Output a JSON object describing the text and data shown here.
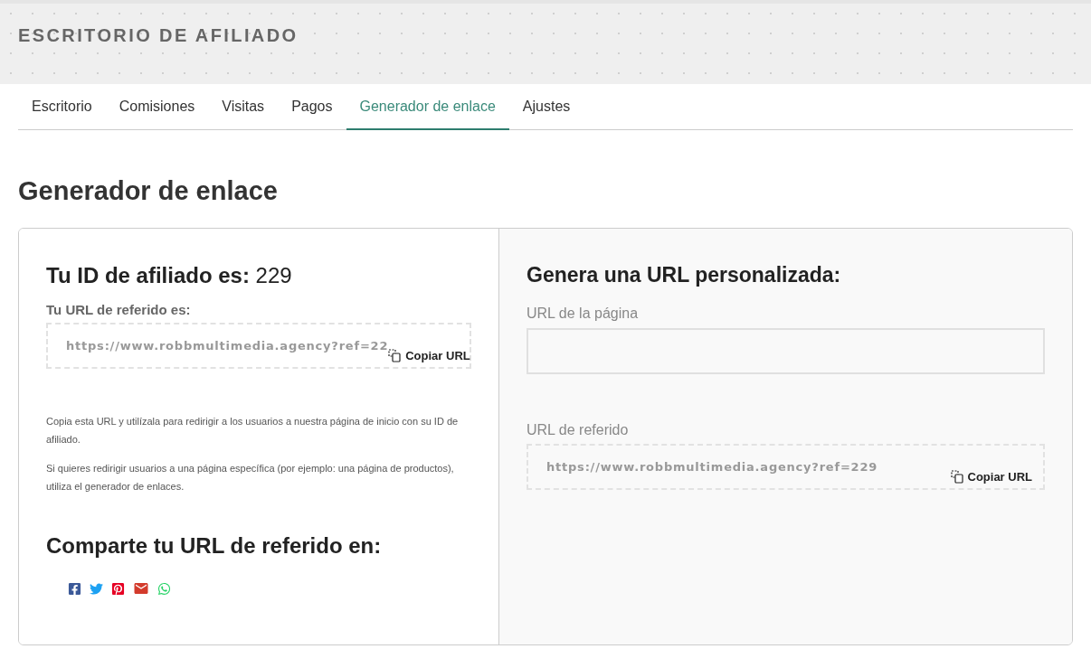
{
  "header": {
    "title": "ESCRITORIO DE AFILIADO"
  },
  "tabs": [
    {
      "label": "Escritorio",
      "selected": false
    },
    {
      "label": "Comisiones",
      "selected": false
    },
    {
      "label": "Visitas",
      "selected": false
    },
    {
      "label": "Pagos",
      "selected": false
    },
    {
      "label": "Generador de enlace",
      "selected": true
    },
    {
      "label": "Ajustes",
      "selected": false
    }
  ],
  "page_title": "Generador de enlace",
  "left": {
    "affiliate_id": "**Tu ID de afiliado es:** 229",
    "url_label": "Tu URL de referido es:",
    "url": "https://www.robbmultimedia.agency?ref=22",
    "copy_label": "Copiar URL",
    "paragraphs": [
      "Copia esta URL y utilízala para redirigir a los usuarios a nuestra página de inicio con su ID de afiliado.",
      "Si quieres redirigir usuarios a una página específica (por ejemplo: una página de productos), utiliza el generador de enlaces."
    ],
    "share_title": "Comparte tu URL de referido en:",
    "share": [
      {
        "kind": "facebook"
      },
      {
        "kind": "twitter"
      },
      {
        "kind": "pinterest"
      },
      {
        "kind": "email"
      },
      {
        "kind": "whatsapp"
      }
    ]
  },
  "right": {
    "title": "Genera una URL personalizada:",
    "page_url_label": "URL de la página",
    "referral_label": "URL de referido",
    "referral_url": "https://www.robbmultimedia.agency?ref=229",
    "copy_label": "Copiar URL"
  }
}
